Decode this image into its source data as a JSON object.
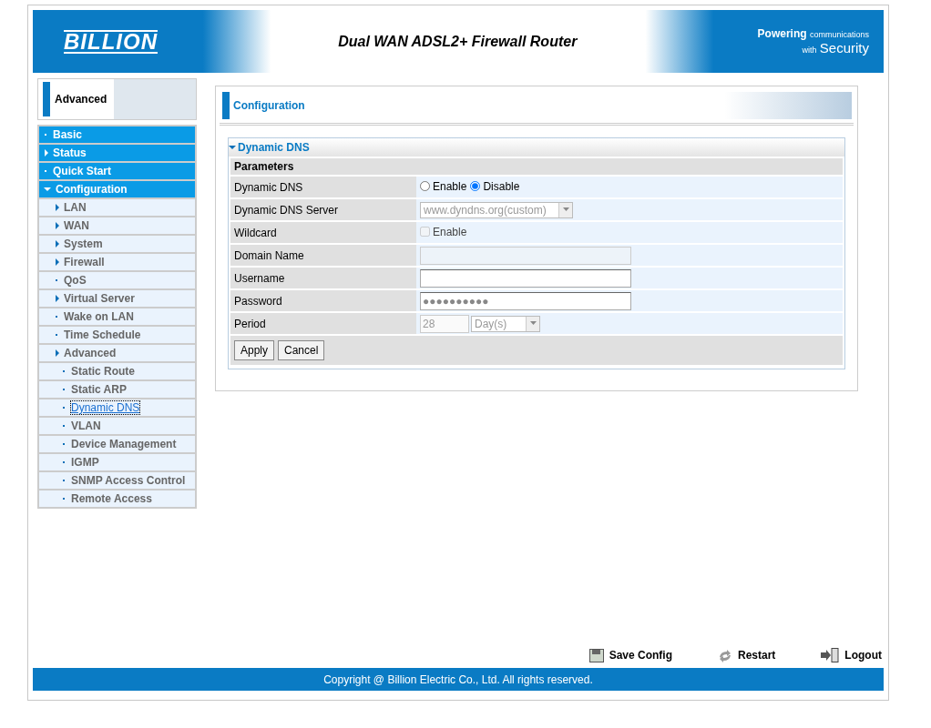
{
  "header": {
    "logo": "BILLION",
    "title": "Dual WAN ADSL2+ Firewall Router",
    "slogan_big": "Powering",
    "slogan_small": "communications",
    "slogan_with": "with",
    "slogan_security": "Security"
  },
  "sidebar": {
    "mode": "Advanced",
    "items": [
      {
        "label": "Basic",
        "kind": "bullet",
        "selected": false
      },
      {
        "label": "Status",
        "kind": "arrow",
        "selected": false
      },
      {
        "label": "Quick Start",
        "kind": "bullet",
        "selected": false
      },
      {
        "label": "Configuration",
        "kind": "arrow-down",
        "selected": false,
        "children": [
          {
            "label": "LAN",
            "kind": "arrow",
            "selected": false
          },
          {
            "label": "WAN",
            "kind": "arrow",
            "selected": false
          },
          {
            "label": "System",
            "kind": "arrow",
            "selected": false
          },
          {
            "label": "Firewall",
            "kind": "arrow",
            "selected": false
          },
          {
            "label": "QoS",
            "kind": "bullet",
            "selected": false
          },
          {
            "label": "Virtual Server",
            "kind": "arrow",
            "selected": false
          },
          {
            "label": "Wake on LAN",
            "kind": "bullet",
            "selected": false
          },
          {
            "label": "Time Schedule",
            "kind": "bullet",
            "selected": false
          },
          {
            "label": "Advanced",
            "kind": "arrow",
            "selected": false,
            "children": [
              {
                "label": "Static Route",
                "kind": "bullet",
                "selected": false
              },
              {
                "label": "Static ARP",
                "kind": "bullet",
                "selected": false
              },
              {
                "label": "Dynamic DNS",
                "kind": "bullet",
                "selected": true
              },
              {
                "label": "VLAN",
                "kind": "bullet",
                "selected": false
              },
              {
                "label": "Device Management",
                "kind": "bullet",
                "selected": false
              },
              {
                "label": "IGMP",
                "kind": "bullet",
                "selected": false
              },
              {
                "label": "SNMP Access Control",
                "kind": "bullet",
                "selected": false
              },
              {
                "label": "Remote Access",
                "kind": "bullet",
                "selected": false
              }
            ]
          }
        ]
      }
    ]
  },
  "page": {
    "title": "Configuration",
    "section": "Dynamic DNS",
    "group": "Parameters",
    "rows": [
      {
        "label": "Dynamic DNS",
        "kind": "radio",
        "options": [
          {
            "label": "Enable",
            "selected": false
          },
          {
            "label": "Disable",
            "selected": true
          }
        ]
      },
      {
        "label": "Dynamic DNS Server",
        "kind": "select",
        "value": "www.dyndns.org(custom)",
        "disabled": true
      },
      {
        "label": "Wildcard",
        "kind": "checkbox",
        "option": "Enable",
        "checked": false,
        "disabled": true
      },
      {
        "label": "Domain Name",
        "kind": "text",
        "disabled": true
      },
      {
        "label": "Username",
        "kind": "text",
        "disabled": false
      },
      {
        "label": "Password",
        "kind": "text",
        "value": "●●●●●●●●●●",
        "disabled": false
      },
      {
        "label": "Period",
        "kind": "period",
        "value": "28",
        "unit": "Day(s)",
        "disabled": true
      }
    ],
    "buttons": [
      "Apply",
      "Cancel"
    ]
  },
  "footer": {
    "links": [
      {
        "label": "Save Config",
        "kind": "save"
      },
      {
        "label": "Restart",
        "kind": "restart"
      },
      {
        "label": "Logout",
        "kind": "logout"
      }
    ],
    "copyright": "Copyright @ Billion Electric Co., Ltd. All rights reserved."
  }
}
